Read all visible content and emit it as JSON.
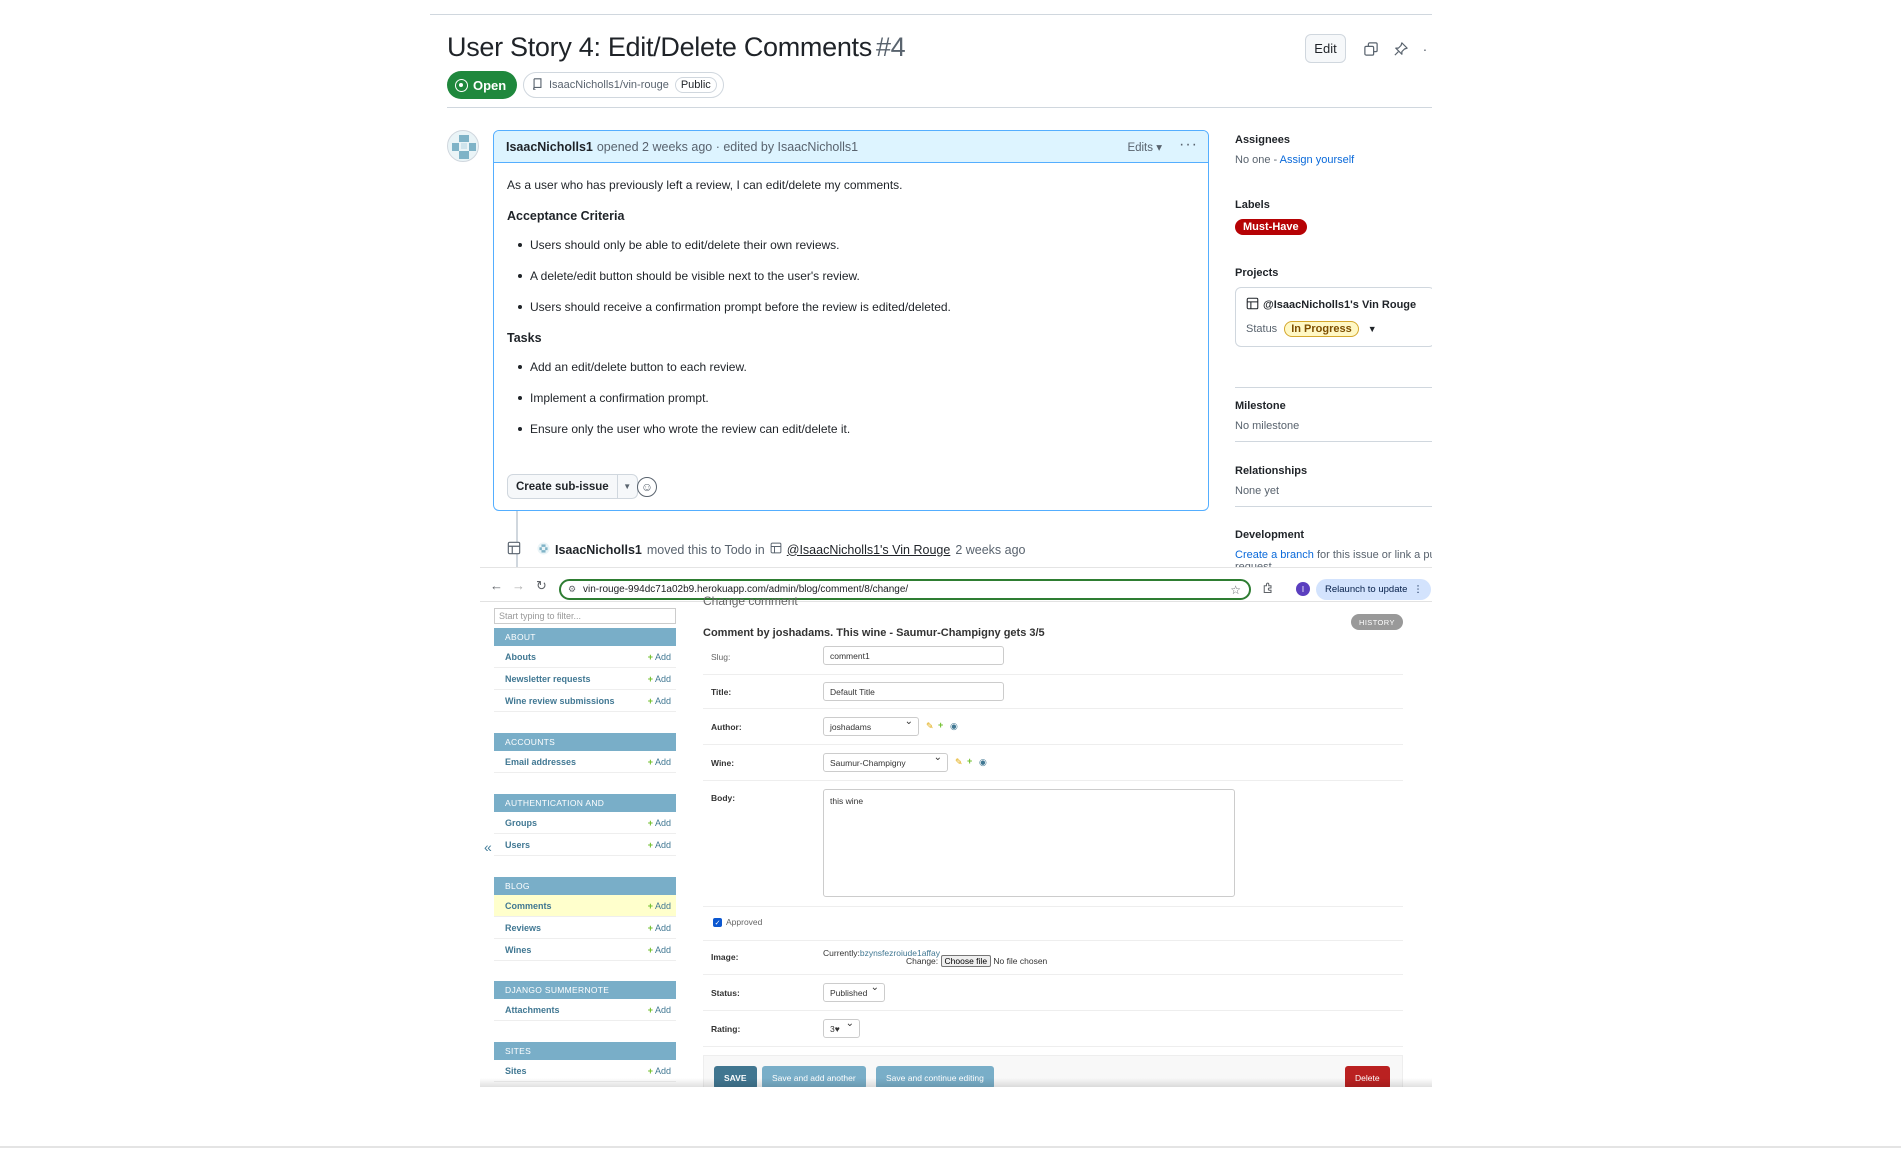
{
  "issue": {
    "title": "User Story 4: Edit/Delete Comments",
    "number": "#4",
    "edit_label": "Edit",
    "state": "Open",
    "repo": "IsaacNicholls1/vin-rouge",
    "visibility": "Public",
    "author": "IsaacNicholls1",
    "opened_text": "opened 2 weeks ago · edited by IsaacNicholls1",
    "edits_label": "Edits",
    "intro": "As a user who has previously left a review, I can edit/delete my comments.",
    "acceptance_heading": "Acceptance Criteria",
    "acceptance": [
      "Users should only be able to edit/delete their own reviews.",
      "A delete/edit button should be visible next to the user's review.",
      "Users should receive a confirmation prompt before the review is edited/deleted."
    ],
    "tasks_heading": "Tasks",
    "tasks": [
      "Add an edit/delete button to each review.",
      "Implement a confirmation prompt.",
      "Ensure only the user who wrote the review can edit/delete it."
    ],
    "create_sub_issue": "Create sub-issue",
    "event": {
      "actor": "IsaacNicholls1",
      "text": "moved this to Todo in",
      "project": "@IsaacNicholls1's Vin Rouge",
      "time": "2 weeks ago"
    }
  },
  "sidebar": {
    "assignees_h": "Assignees",
    "assignees_none": "No one - ",
    "assign_yourself": "Assign yourself",
    "labels_h": "Labels",
    "label": "Must-Have",
    "label_color": "#b60205",
    "projects_h": "Projects",
    "project_name": "@IsaacNicholls1's Vin Rouge",
    "status_label": "Status",
    "status_value": "In Progress",
    "milestone_h": "Milestone",
    "milestone_value": "No milestone",
    "relationships_h": "Relationships",
    "relationships_value": "None yet",
    "development_h": "Development",
    "create_branch": "Create a branch",
    "development_rest": " for this issue or link a pul",
    "development_rest2": "request."
  },
  "browser": {
    "url": "vin-rouge-994dc71a02b9.herokuapp.com/admin/blog/comment/8/change/",
    "relaunch": "Relaunch to update",
    "profile_initial": "I"
  },
  "admin": {
    "filter_placeholder": "Start typing to filter...",
    "add_label": "Add",
    "collapse": "«",
    "modules": [
      {
        "name": "ABOUT",
        "rows": [
          "Abouts",
          "Newsletter requests",
          "Wine review submissions"
        ]
      },
      {
        "name": "ACCOUNTS",
        "rows": [
          "Email addresses"
        ]
      },
      {
        "name": "AUTHENTICATION AND AUTHORIZATION",
        "rows": [
          "Groups",
          "Users"
        ]
      },
      {
        "name": "BLOG",
        "rows": [
          "Comments",
          "Reviews",
          "Wines"
        ]
      },
      {
        "name": "DJANGO SUMMERNOTE",
        "rows": [
          "Attachments"
        ]
      },
      {
        "name": "SITES",
        "rows": [
          "Sites"
        ]
      }
    ],
    "change_header": "Change comment",
    "form_title": "Comment by joshadams. This wine - Saumur-Champigny gets 3/5",
    "history": "HISTORY",
    "slug_label": "Slug:",
    "slug_value": "comment1",
    "title_label": "Title:",
    "title_value": "Default Title",
    "author_label": "Author:",
    "author_value": "joshadams",
    "wine_label": "Wine:",
    "wine_value": "Saumur-Champigny",
    "body_label": "Body:",
    "body_value": "this wine",
    "approved_label": "Approved",
    "image_label": "Image:",
    "currently_label": "Currently:",
    "image_file": "bzynsfezroiude1affay",
    "change_label": "Change:",
    "choose_file": "Choose file",
    "no_file": "No file chosen",
    "status_label": "Status:",
    "status_value": "Published",
    "rating_label": "Rating:",
    "rating_value": "3♥",
    "save": "SAVE",
    "save_add": "Save and add another",
    "save_continue": "Save and continue editing",
    "delete": "Delete"
  }
}
